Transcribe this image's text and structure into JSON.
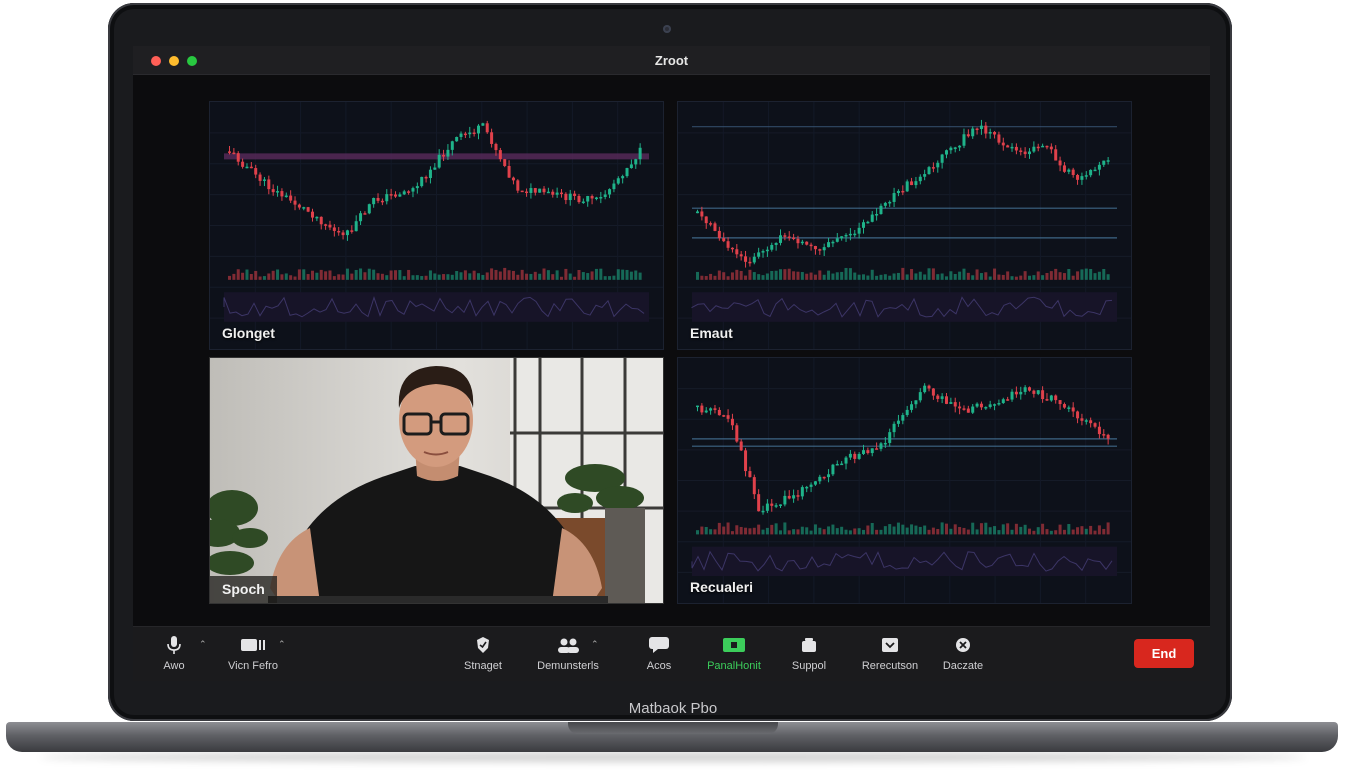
{
  "app": {
    "title": "Zroot"
  },
  "device": {
    "label": "Matbaok Pbo"
  },
  "tiles": [
    {
      "label": "Glonget"
    },
    {
      "label": "Emaut"
    },
    {
      "label": "Spoch"
    },
    {
      "label": "Recualeri"
    }
  ],
  "toolbar": {
    "items": [
      {
        "label": "Awo",
        "icon": "microphone-icon"
      },
      {
        "label": "Vicn Fefro",
        "icon": "video-camera-icon"
      },
      {
        "label": "Stnaget",
        "icon": "security-icon"
      },
      {
        "label": "Demunsterls",
        "icon": "participants-icon"
      },
      {
        "label": "Acos",
        "icon": "chat-icon"
      },
      {
        "label": "PanalHonit",
        "icon": "share-screen-icon",
        "active": true
      },
      {
        "label": "Suppol",
        "icon": "record-icon"
      },
      {
        "label": "Rerecutson",
        "icon": "reactions-icon"
      },
      {
        "label": "Daczate",
        "icon": "apps-icon"
      }
    ],
    "end_label": "End"
  },
  "colors": {
    "up": "#1fb38a",
    "down": "#e0414b",
    "active": "#3ccd5b",
    "end": "#d8271e"
  }
}
